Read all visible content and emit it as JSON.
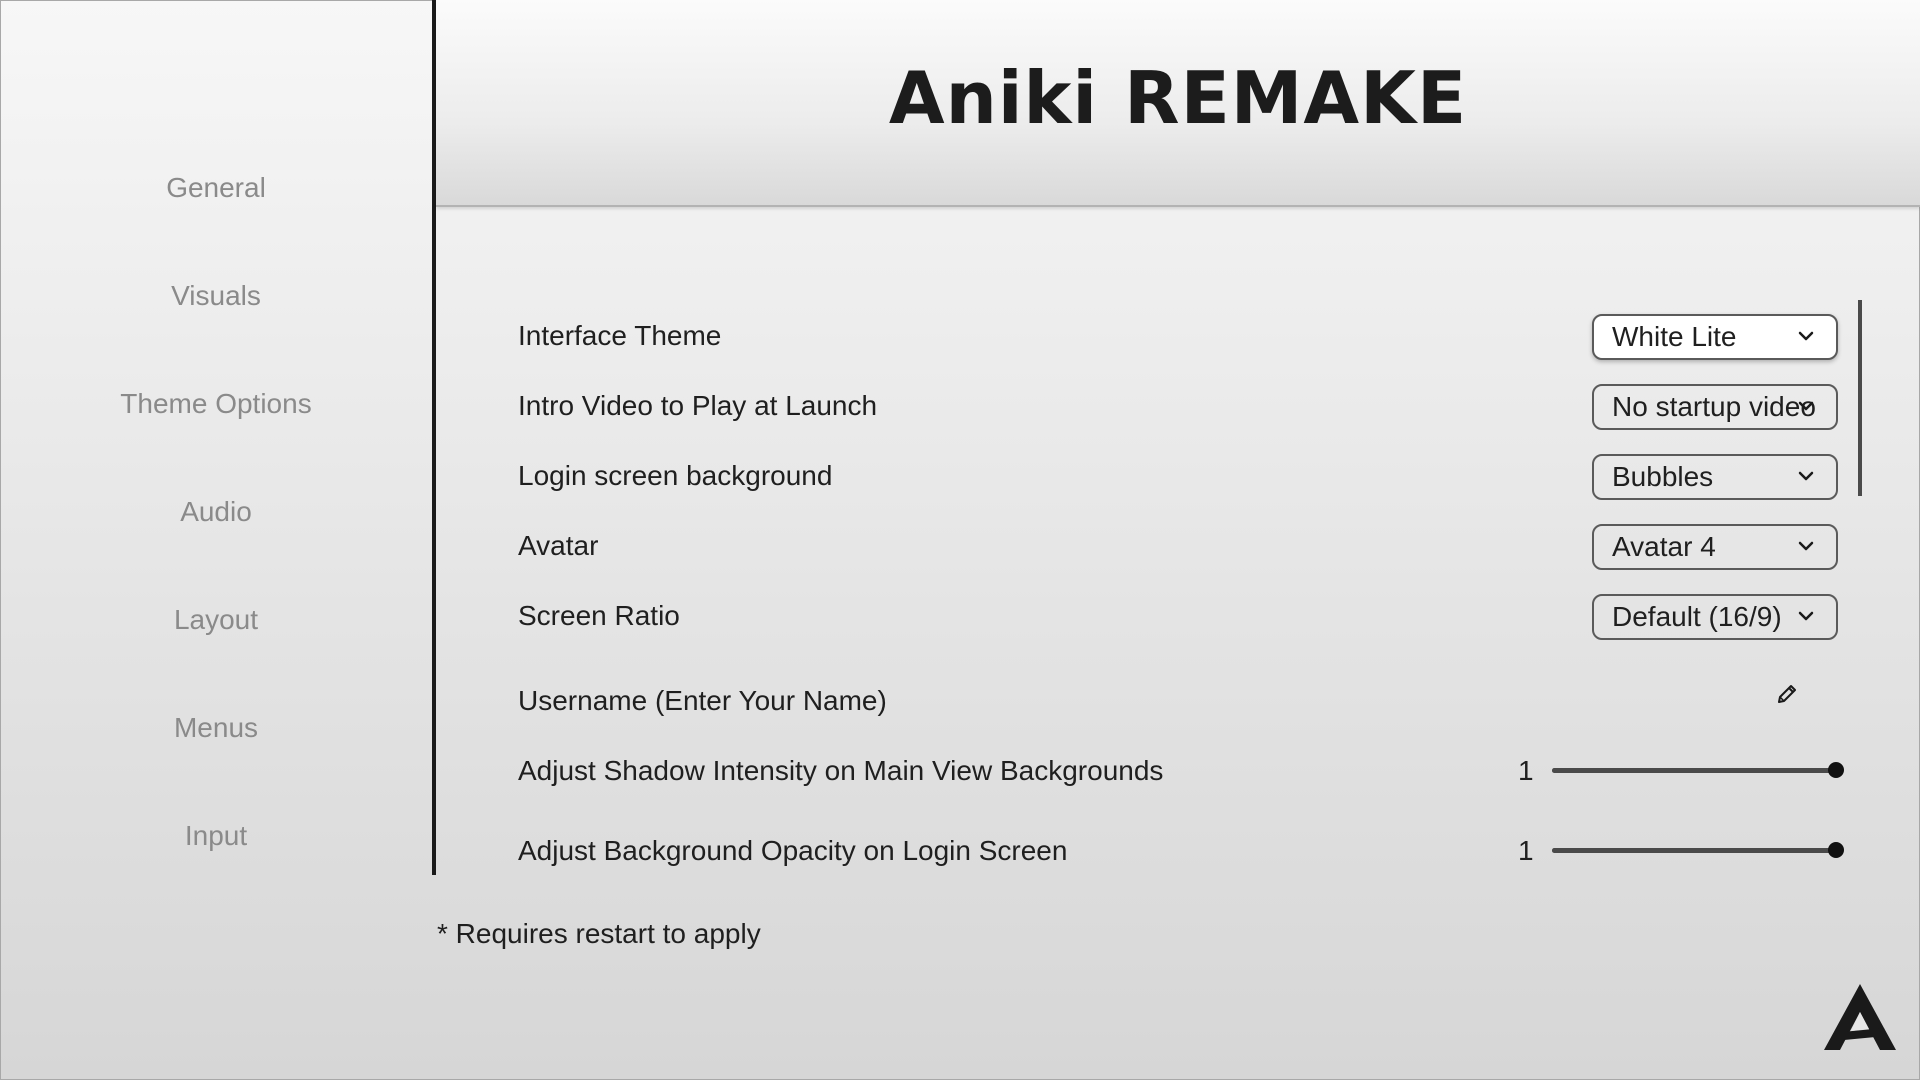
{
  "sidebar": {
    "items": [
      {
        "label": "General"
      },
      {
        "label": "Visuals"
      },
      {
        "label": "Theme Options"
      },
      {
        "label": "Audio"
      },
      {
        "label": "Layout"
      },
      {
        "label": "Menus"
      },
      {
        "label": "Input"
      }
    ]
  },
  "header": {
    "title": "Aniki REMAKE"
  },
  "settings": {
    "interface_theme": {
      "label": "Interface Theme",
      "value": "White Lite"
    },
    "intro_video": {
      "label": "Intro Video to Play at Launch",
      "value": "No startup video"
    },
    "login_background": {
      "label": "Login screen background",
      "value": "Bubbles"
    },
    "avatar": {
      "label": "Avatar",
      "value": "Avatar 4"
    },
    "screen_ratio": {
      "label": "Screen Ratio",
      "value": "Default (16/9)"
    },
    "username": {
      "label": "Username (Enter Your Name)",
      "icon": "pencil-icon"
    },
    "shadow_intensity": {
      "label": "Adjust Shadow Intensity on Main View Backgrounds",
      "value": "1",
      "fraction": 1.0
    },
    "background_opacity": {
      "label": "Adjust Background Opacity on Login Screen",
      "value": "1",
      "fraction": 1.0
    }
  },
  "footnote": "* Requires restart to apply",
  "logo": {
    "icon": "aniki-logo"
  },
  "colors": {
    "sidebar_text": "#8a8a8a",
    "text": "#1f1f1f",
    "accent_dark": "#1a1a1a"
  }
}
